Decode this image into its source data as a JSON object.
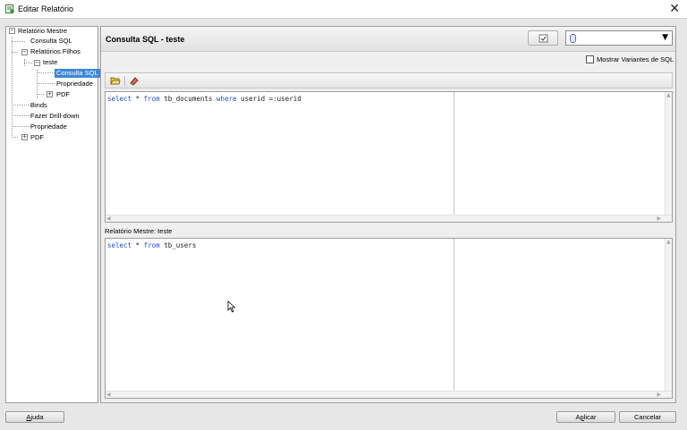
{
  "window": {
    "title": "Editar Relatório",
    "close_glyph": "✕"
  },
  "tree": {
    "root": "Relatório Mestre",
    "consulta_sql": "Consulta SQL",
    "relatorios_filhos": "Relatórios Filhos",
    "teste": "teste",
    "teste_consulta_sql": "Consulta SQL",
    "teste_propriedade": "Propriedade",
    "teste_pdf": "PDF",
    "binds": "Binds",
    "fazer_drill_down": "Fazer Drill-down",
    "propriedade": "Propriedade",
    "pdf": "PDF"
  },
  "panel": {
    "title": "Consulta SQL - teste",
    "variants_label": "Mostrar Variantes de SQL",
    "variants_checked": false,
    "master_label": "Relatório Mestre:  teste"
  },
  "query": {
    "kw_select": "select",
    "star": " * ",
    "kw_from": "from",
    "table": " tb_documents ",
    "kw_where": "where",
    "condition": " userid =:userid"
  },
  "master_query": {
    "kw_select": "select",
    "star": " * ",
    "kw_from": "from",
    "table": " tb_users"
  },
  "buttons": {
    "help_pre": "",
    "help_underline": "A",
    "help_post": "juda",
    "apply_pre": "A",
    "apply_underline": "p",
    "apply_post": "licar",
    "cancel": "Cancelar"
  },
  "icons": {
    "app": "report-edit-icon",
    "refresh": "checklist-icon",
    "connection": "database-icon",
    "open": "folder-open-icon",
    "clear": "eraser-icon"
  },
  "colors": {
    "keyword": "#1e4fd8",
    "selection": "#3c88d8"
  }
}
